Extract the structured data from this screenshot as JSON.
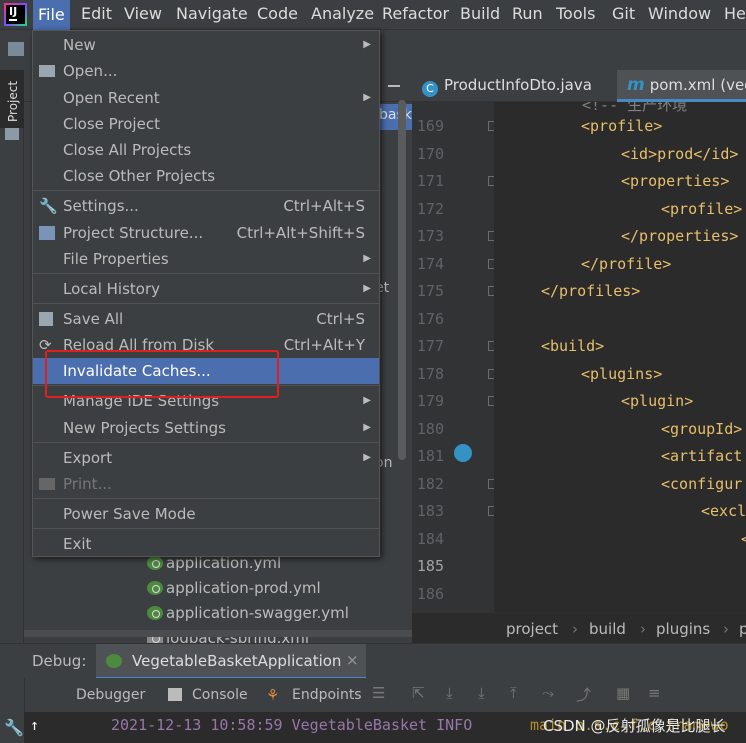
{
  "menubar": {
    "items": [
      "File",
      "Edit",
      "View",
      "Navigate",
      "Code",
      "Analyze",
      "Refactor",
      "Build",
      "Run",
      "Tools",
      "Git",
      "Window",
      "He"
    ]
  },
  "left_strip": {
    "project_tab": "Project"
  },
  "editor": {
    "tabs": [
      "ProductInfoDto.java",
      "pom.xml (veg"
    ],
    "line_numbers": [
      "169",
      "170",
      "171",
      "172",
      "173",
      "174",
      "175",
      "176",
      "177",
      "178",
      "179",
      "180",
      "181",
      "182",
      "183",
      "184",
      "185",
      "186"
    ],
    "lines": [
      "<profile>",
      "<id>prod</id>",
      "<properties>",
      "<profile>",
      "</properties>",
      "</profile>",
      "</profiles>",
      "",
      "<build>",
      "<plugins>",
      "<plugin>",
      "<groupId>",
      "<artifact",
      "<configur",
      "<excl",
      "<",
      "",
      ""
    ],
    "top_partial": "<!-- 生产环境",
    "breadcrumbs": [
      "project",
      "build",
      "plugins",
      "p"
    ]
  },
  "project_tree": {
    "partial_right": [
      "baske",
      "et",
      "on"
    ],
    "files": [
      "application.yml",
      "application-prod.yml",
      "application-swagger.yml",
      "logback-spring.xml"
    ]
  },
  "file_menu": {
    "items": [
      {
        "label": "New",
        "shortcut": "",
        "submenu": true
      },
      {
        "label": "Open...",
        "shortcut": "",
        "submenu": false
      },
      {
        "label": "Open Recent",
        "shortcut": "",
        "submenu": true
      },
      {
        "label": "Close Project",
        "shortcut": "",
        "submenu": false
      },
      {
        "label": "Close All Projects",
        "shortcut": "",
        "submenu": false
      },
      {
        "label": "Close Other Projects",
        "shortcut": "",
        "submenu": false
      },
      {
        "label": "Settings...",
        "shortcut": "Ctrl+Alt+S",
        "submenu": false
      },
      {
        "label": "Project Structure...",
        "shortcut": "Ctrl+Alt+Shift+S",
        "submenu": false
      },
      {
        "label": "File Properties",
        "shortcut": "",
        "submenu": true
      },
      {
        "label": "Local History",
        "shortcut": "",
        "submenu": true
      },
      {
        "label": "Save All",
        "shortcut": "Ctrl+S",
        "submenu": false
      },
      {
        "label": "Reload All from Disk",
        "shortcut": "Ctrl+Alt+Y",
        "submenu": false
      },
      {
        "label": "Invalidate Caches...",
        "shortcut": "",
        "submenu": false
      },
      {
        "label": "Manage IDE Settings",
        "shortcut": "",
        "submenu": true
      },
      {
        "label": "New Projects Settings",
        "shortcut": "",
        "submenu": true
      },
      {
        "label": "Export",
        "shortcut": "",
        "submenu": true
      },
      {
        "label": "Print...",
        "shortcut": "",
        "submenu": false
      },
      {
        "label": "Power Save Mode",
        "shortcut": "",
        "submenu": false
      },
      {
        "label": "Exit",
        "shortcut": "",
        "submenu": false
      }
    ]
  },
  "debug": {
    "label": "Debug:",
    "config": "VegetableBasketApplication",
    "tabs": [
      "Debugger",
      "Console",
      "Endpoints"
    ],
    "console_line": "2021-12-13 10:58:59 VegetableBasket INFO",
    "console_tail": "main o.s.c.f.c.framewo"
  },
  "watermark": "CSDN @反射孤像是比腿长",
  "colors": {
    "accent": "#4b6eaf",
    "highlight_box": "#e02020",
    "bg": "#2b2b2b",
    "panel": "#3c3f41"
  }
}
